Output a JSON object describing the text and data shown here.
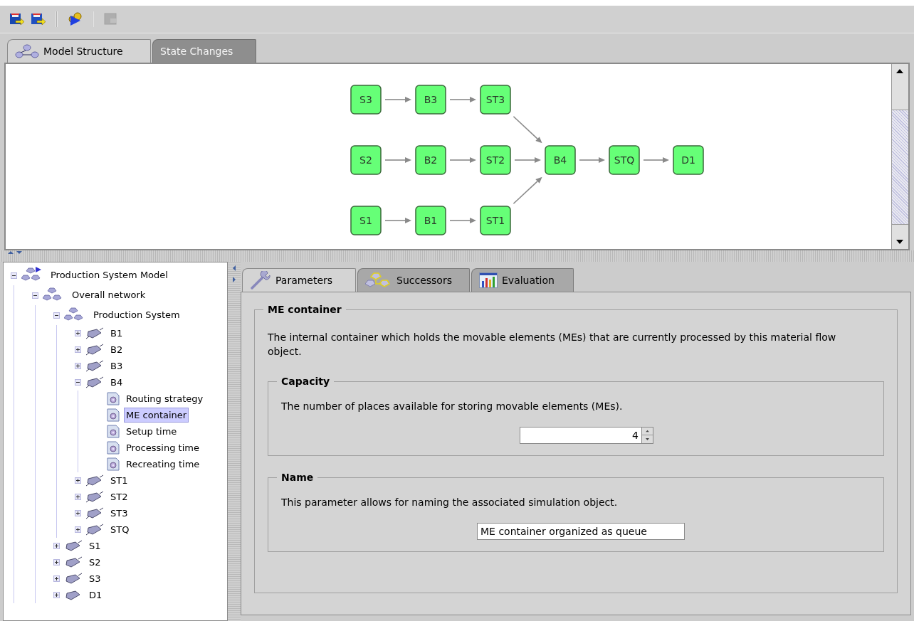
{
  "toolbar": [
    {
      "kind": "button",
      "disabled": false
    },
    {
      "kind": "button",
      "disabled": false
    },
    {
      "kind": "separator"
    },
    {
      "kind": "button",
      "disabled": false
    },
    {
      "kind": "separator"
    },
    {
      "kind": "button",
      "disabled": true
    }
  ],
  "main_tabs": [
    {
      "label": "Model Structure",
      "selected": true,
      "disabled": false
    },
    {
      "label": "State Changes",
      "selected": false,
      "disabled": true
    }
  ],
  "diagram": {
    "nodes": [
      {
        "label": "S3"
      },
      {
        "label": "B3"
      },
      {
        "label": "ST3"
      },
      {
        "label": "S2"
      },
      {
        "label": "B2"
      },
      {
        "label": "ST2"
      },
      {
        "label": "B4"
      },
      {
        "label": "STQ"
      },
      {
        "label": "D1"
      },
      {
        "label": "S1"
      },
      {
        "label": "B1"
      },
      {
        "label": "ST1"
      }
    ]
  },
  "tree": [
    {
      "label": "Production System Model",
      "kind": "model",
      "expanded": true,
      "selected": false,
      "children": [
        {
          "label": "Overall network",
          "kind": "network",
          "expanded": true,
          "selected": false,
          "children": [
            {
              "label": "Production System",
              "kind": "network",
              "expanded": true,
              "selected": false,
              "children": [
                {
                  "label": "B1",
                  "kind": "object",
                  "expanded": false,
                  "selected": false
                },
                {
                  "label": "B2",
                  "kind": "object",
                  "expanded": false,
                  "selected": false
                },
                {
                  "label": "B3",
                  "kind": "object",
                  "expanded": false,
                  "selected": false
                },
                {
                  "label": "B4",
                  "kind": "object",
                  "expanded": true,
                  "selected": false,
                  "children": [
                    {
                      "label": "Routing strategy",
                      "kind": "parameter",
                      "selected": false
                    },
                    {
                      "label": "ME container",
                      "kind": "parameter",
                      "selected": true
                    },
                    {
                      "label": "Setup time",
                      "kind": "parameter",
                      "selected": false
                    },
                    {
                      "label": "Processing time",
                      "kind": "parameter",
                      "selected": false
                    },
                    {
                      "label": "Recreating time",
                      "kind": "parameter",
                      "selected": false
                    }
                  ]
                },
                {
                  "label": "ST1",
                  "kind": "object",
                  "expanded": false,
                  "selected": false
                },
                {
                  "label": "ST2",
                  "kind": "object",
                  "expanded": false,
                  "selected": false
                },
                {
                  "label": "ST3",
                  "kind": "object",
                  "expanded": false,
                  "selected": false
                },
                {
                  "label": "STQ",
                  "kind": "object",
                  "expanded": false,
                  "selected": false
                }
              ]
            },
            {
              "label": "S1",
              "kind": "source",
              "expanded": false,
              "selected": false
            },
            {
              "label": "S2",
              "kind": "source",
              "expanded": false,
              "selected": false
            },
            {
              "label": "S3",
              "kind": "source",
              "expanded": false,
              "selected": false
            },
            {
              "label": "D1",
              "kind": "drain",
              "expanded": false,
              "selected": false
            }
          ]
        }
      ]
    }
  ],
  "detail_tabs": [
    {
      "label": "Parameters",
      "selected": true
    },
    {
      "label": "Successors",
      "selected": false
    },
    {
      "label": "Evaluation",
      "selected": false
    }
  ],
  "parameter": {
    "title": "ME container",
    "description": "The internal container which holds the movable elements (MEs) that are currently processed by this material flow object.",
    "groups": [
      {
        "title": "Capacity",
        "description": "The number of places available for storing movable elements (MEs).",
        "kind": "spinner",
        "value": "4"
      },
      {
        "title": "Name",
        "description": "This parameter allows for naming the associated simulation object.",
        "kind": "text",
        "value": "ME container organized as queue"
      }
    ]
  }
}
